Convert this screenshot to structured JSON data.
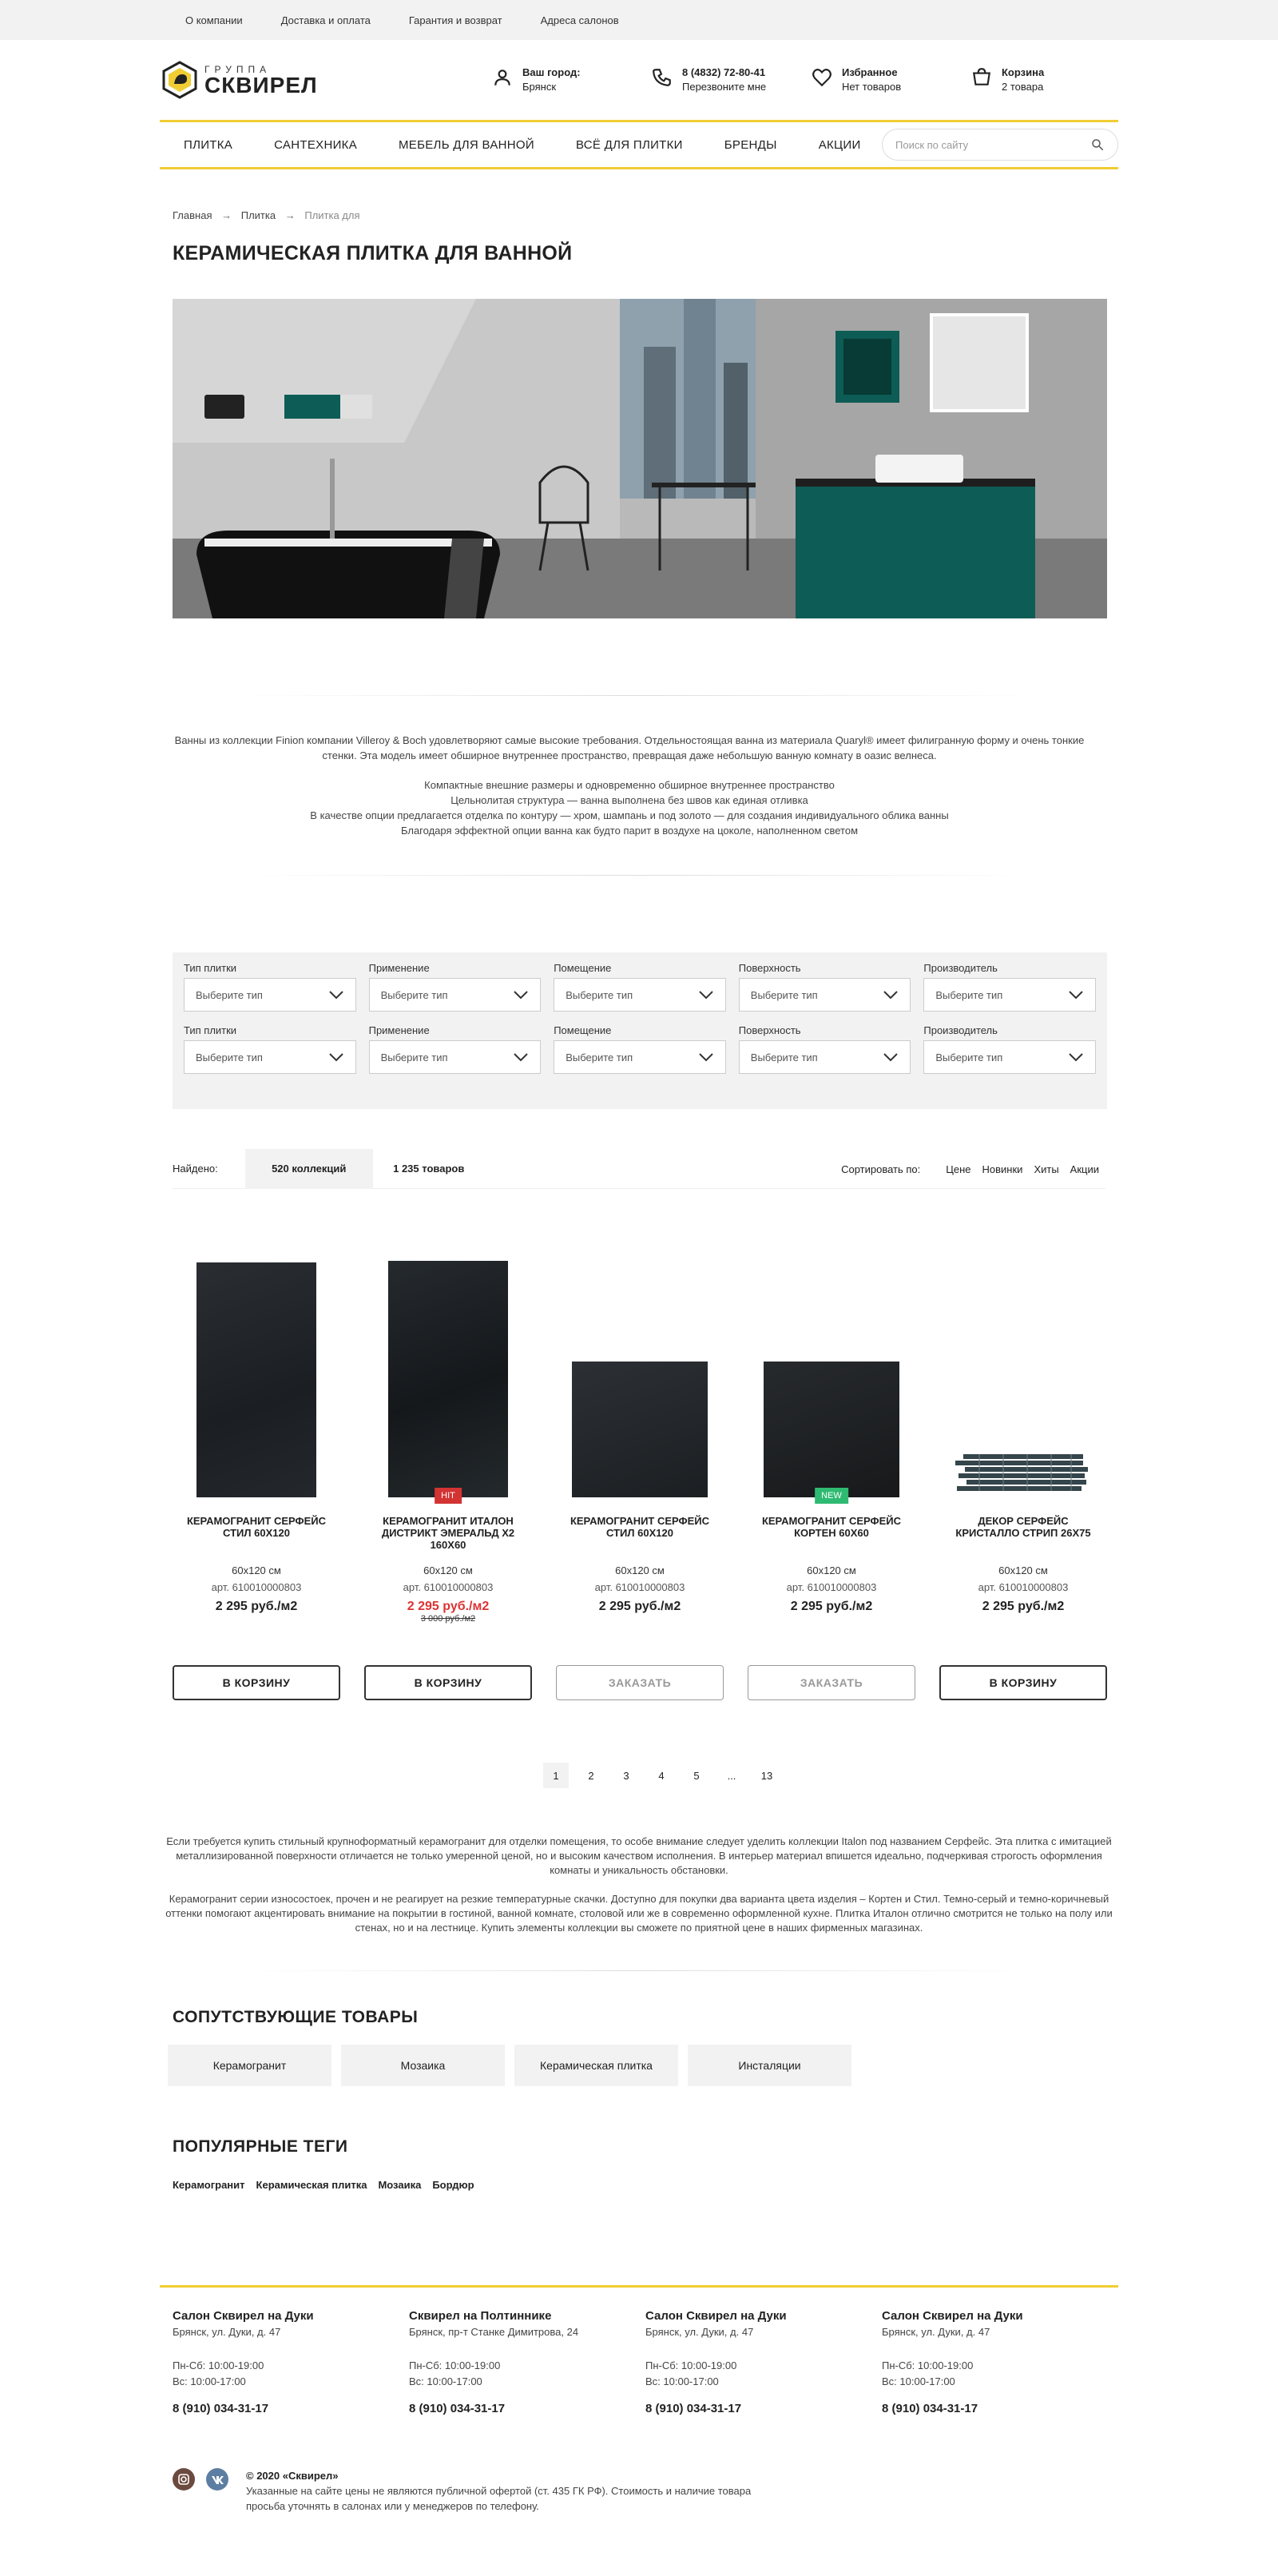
{
  "topbar": {
    "links": [
      "О компании",
      "Доставка и оплата",
      "Гарантия и возврат",
      "Адреса салонов"
    ]
  },
  "header": {
    "logo_small": "группа",
    "logo_big": "Сквирел",
    "city_label": "Ваш город:",
    "city_value": "Брянск",
    "phone": "8 (4832) 72-80-41",
    "callback": "Перезвоните мне",
    "fav_label": "Избранное",
    "fav_value": "Нет товаров",
    "cart_label": "Корзина",
    "cart_value": "2 товара"
  },
  "nav": {
    "items": [
      "ПЛИТКА",
      "САНТЕХНИКА",
      "МЕБЕЛЬ ДЛЯ ВАННОЙ",
      "ВСЁ ДЛЯ ПЛИТКИ",
      "БРЕНДЫ",
      "АКЦИИ"
    ],
    "search_placeholder": "Поиск по сайту"
  },
  "breadcrumbs": {
    "items": [
      "Главная",
      "Плитка",
      "Плитка для"
    ],
    "sep": "→"
  },
  "page_title": "КЕРАМИЧЕСКАЯ ПЛИТКА ДЛЯ ВАННОЙ",
  "description": {
    "p1": "Ванны из коллекции Finion компании Villeroy & Boch удовлетворяют самые высокие требования. Отдельностоящая ванна из материала Quaryl® имеет филигранную форму и очень тонкие стенки. Эта модель имеет обширное внутреннее пространство, превращая даже небольшую ванную комнату в оазис велнеса.",
    "l1": "Компактные внешние размеры и одновременно обширное внутреннее пространство",
    "l2": "Цельнолитая структура — ванна выполнена без швов как единая отливка",
    "l3": "В качестве опции предлагается отделка по контуру — хром, шампань и под золото — для создания индивидуального облика ванны",
    "l4": "Благодаря эффектной опции ванна как будто парит в воздухе на цоколе, наполненном светом"
  },
  "filters": {
    "labels": [
      "Тип плитки",
      "Применение",
      "Помещение",
      "Поверхность",
      "Производитель"
    ],
    "placeholder": "Выберите тип"
  },
  "found": {
    "label": "Найдено:",
    "tab_collections": "520 коллекций",
    "tab_products": "1 235 товаров",
    "sort_label": "Сортировать по:",
    "sort_options": [
      "Цене",
      "Новинки",
      "Хиты",
      "Акции"
    ]
  },
  "products": [
    {
      "name": "КЕРАМОГРАНИТ СЕРФЕЙС СТИЛ 60X120",
      "size": "60x120 см",
      "art": "арт. 610010000803",
      "price": "2 295 руб./м2",
      "old_price": "",
      "badge": "",
      "button": "В КОРЗИНУ"
    },
    {
      "name": "КЕРАМОГРАНИТ ИТАЛОН ДИСТРИКТ ЭМЕРАЛЬД Х2 160X60",
      "size": "60x120 см",
      "art": "арт. 610010000803",
      "price": "2 295 руб./м2",
      "old_price": "3 000 руб./м2",
      "badge": "HIT",
      "button": "В КОРЗИНУ"
    },
    {
      "name": "КЕРАМОГРАНИТ СЕРФЕЙС СТИЛ 60X120",
      "size": "60x120 см",
      "art": "арт. 610010000803",
      "price": "2 295 руб./м2",
      "old_price": "",
      "badge": "",
      "button": "ЗАКАЗАТЬ"
    },
    {
      "name": "КЕРАМОГРАНИТ СЕРФЕЙС КОРТЕН 60X60",
      "size": "60x120 см",
      "art": "арт. 610010000803",
      "price": "2 295 руб./м2",
      "old_price": "",
      "badge": "NEW",
      "button": "ЗАКАЗАТЬ"
    },
    {
      "name": "ДЕКОР СЕРФЕЙС КРИСТАЛЛО СТРИП 26X75",
      "size": "60x120 см",
      "art": "арт. 610010000803",
      "price": "2 295 руб./м2",
      "old_price": "",
      "badge": "",
      "button": "В КОРЗИНУ"
    }
  ],
  "pagination": {
    "pages": [
      "1",
      "2",
      "3",
      "4",
      "5",
      "...",
      "13"
    ]
  },
  "seo": {
    "p1": "Если требуется купить стильный крупноформатный керамогранит для отделки помещения, то особе внимание следует уделить коллекции Italon под названием Серфейс. Эта плитка с имитацией металлизированной поверхности отличается не только умеренной ценой, но и высоким качеством исполнения. В интерьер материал впишется идеально, подчеркивая строгость оформления комнаты и уникальность обстановки.",
    "p2": "Керамогранит серии износостоек, прочен и не реагирует на резкие температурные скачки. Доступно для покупки два варианта цвета изделия – Кортен и Стил. Темно-серый и темно-коричневый оттенки помогают акцентировать внимание на покрытии в гостиной, ванной комнате, столовой или же в современно оформленной кухне. Плитка Италон отлично смотрится не только на полу или стенах, но и на лестнице. Купить элементы коллекции вы сможете по приятной цене в наших фирменных магазинах."
  },
  "related": {
    "title": "СОПУТСТВУЮЩИЕ ТОВАРЫ",
    "items": [
      "Керамогранит",
      "Мозаика",
      "Керамическая плитка",
      "Инсталяции"
    ]
  },
  "popular_tags": {
    "title": "ПОПУЛЯРНЫЕ ТЕГИ",
    "items": [
      "Керамогранит",
      "Керамическая плитка",
      "Мозаика",
      "Бордюр"
    ]
  },
  "footer": {
    "salons": [
      {
        "name": "Салон Сквирел на Дуки",
        "addr": "Брянск, ул. Дуки, д. 47",
        "h1": "Пн-Сб: 10:00-19:00",
        "h2": "Вс: 10:00-17:00",
        "phone": "8 (910) 034-31-17"
      },
      {
        "name": "Сквирел на Полтиннике",
        "addr": "Брянск, пр-т Станке Димитрова, 24",
        "h1": "Пн-Сб: 10:00-19:00",
        "h2": "Вс: 10:00-17:00",
        "phone": "8 (910) 034-31-17"
      },
      {
        "name": "Салон Сквирел на Дуки",
        "addr": "Брянск, ул. Дуки, д. 47",
        "h1": "Пн-Сб: 10:00-19:00",
        "h2": "Вс: 10:00-17:00",
        "phone": "8 (910) 034-31-17"
      },
      {
        "name": "Салон Сквирел на Дуки",
        "addr": "Брянск, ул. Дуки, д. 47",
        "h1": "Пн-Сб: 10:00-19:00",
        "h2": "Вс: 10:00-17:00",
        "phone": "8 (910) 034-31-17"
      }
    ],
    "copyright": "© 2020 «Сквирел»",
    "disclaimer": "Указанные на сайте цены не являются публичной офертой (ст. 435 ГК РФ). Стоимость и наличие товара просьба уточнять в салонах или у менеджеров по телефону.",
    "social": [
      "instagram",
      "vk"
    ]
  },
  "colors": {
    "accent": "#f0cd33",
    "hit": "#d33333",
    "new": "#2fba72",
    "teal": "#0d5c55"
  }
}
